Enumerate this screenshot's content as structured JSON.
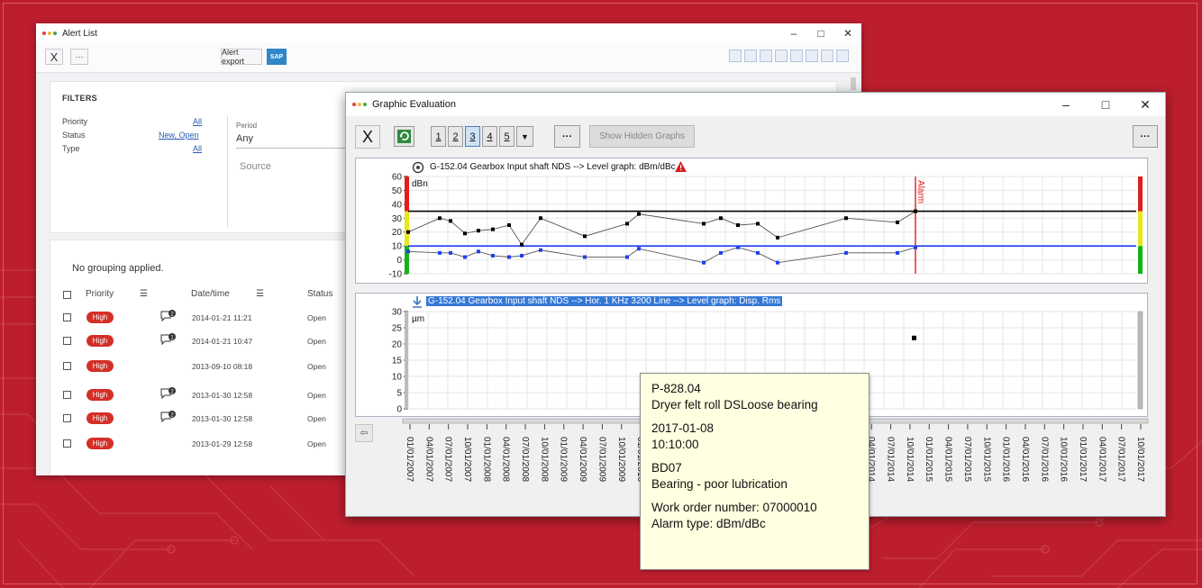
{
  "colors": {
    "background": "#bd1e2d",
    "pill": "#d32f27",
    "link": "#2a5db0",
    "selection": "#3478d6",
    "tooltip_bg": "#ffffe1"
  },
  "alert_window": {
    "title": "Alert List",
    "toolbar": {
      "close_glyph": "X",
      "more_glyph": "···",
      "export_label": "Alert export",
      "sap_label": "SAP"
    },
    "filters": {
      "heading": "FILTERS",
      "rows": [
        {
          "label": "Priority",
          "value": "All"
        },
        {
          "label": "Status",
          "value": "New, Open"
        },
        {
          "label": "Type",
          "value": "All"
        }
      ],
      "period_label": "Period",
      "period_value": "Any",
      "source_placeholder": "Source"
    },
    "list": {
      "grouping_text": "No grouping applied.",
      "columns": {
        "priority": "Priority",
        "datetime": "Date/time",
        "status": "Status"
      },
      "rows": [
        {
          "priority": "High",
          "comments": "2",
          "datetime": "2014-01-21 11:21",
          "status": "Open"
        },
        {
          "priority": "High",
          "comments": "1",
          "datetime": "2014-01-21 10:47",
          "status": "Open"
        },
        {
          "priority": "High",
          "comments": "",
          "datetime": "2013-09-10 08:18",
          "status": "Open"
        },
        {
          "priority": "High",
          "comments": "2",
          "datetime": "2013-01-30 12:58",
          "status": "Open"
        },
        {
          "priority": "High",
          "comments": "2",
          "datetime": "2013-01-30 12:58",
          "status": "Open"
        },
        {
          "priority": "High",
          "comments": "",
          "datetime": "2013-01-29 12:58",
          "status": "Open"
        }
      ]
    }
  },
  "graph_window": {
    "title": "Graphic Evaluation",
    "toolbar": {
      "close_glyph": "X",
      "pages": [
        "1",
        "2",
        "3",
        "4",
        "5"
      ],
      "selected_page": "3",
      "more_glyph": "···",
      "hidden_graphs_label": "Show Hidden Graphs"
    },
    "panel1": {
      "title": "G-152.04 Gearbox Input shaft NDS --> Level graph: dBm/dBc",
      "unit": "dBn",
      "alarm_label": "Alarm",
      "yticks": [
        "60",
        "50",
        "40",
        "30",
        "20",
        "10",
        "0",
        "-10"
      ]
    },
    "panel2": {
      "title": "G-152.04 Gearbox Input shaft NDS --> Hor. 1 KHz 3200 Line --> Level graph: Disp. Rms",
      "unit": "µm",
      "yticks": [
        "30",
        "25",
        "20",
        "15",
        "10",
        "5",
        "0"
      ]
    },
    "xaxis_labels": [
      "01/01/2007",
      "04/01/2007",
      "07/01/2007",
      "10/01/2007",
      "01/01/2008",
      "04/01/2008",
      "07/01/2008",
      "10/01/2008",
      "01/01/2009",
      "04/01/2009",
      "07/01/2009",
      "10/01/2009",
      "01/01/2010",
      "04/01/2010",
      "",
      "",
      "",
      "",
      "",
      "",
      "",
      "",
      "",
      "01/01/2014",
      "04/01/2014",
      "07/01/2014",
      "10/01/2014",
      "01/01/2015",
      "04/01/2015",
      "07/01/2015",
      "10/01/2015",
      "01/01/2016",
      "04/01/2016",
      "07/01/2016",
      "10/01/2016",
      "01/01/2017",
      "04/01/2017",
      "07/01/2017",
      "10/01/2017"
    ],
    "xaxis_partial": "10/01/2013"
  },
  "chart_data": [
    {
      "type": "line",
      "title": "G-152.04 Gearbox Input shaft NDS --> Level graph: dBm/dBc",
      "ylabel": "dBn",
      "ylim": [
        -10,
        60
      ],
      "series": [
        {
          "values": [
            20,
            30,
            28,
            19,
            21,
            22,
            25,
            11,
            30,
            17,
            26,
            33,
            26,
            30,
            25,
            26,
            16,
            30,
            27,
            35
          ]
        },
        {
          "values": [
            6,
            5,
            5,
            2,
            6,
            3,
            2,
            3,
            7,
            2,
            2,
            8,
            -2,
            5,
            9,
            5,
            -2,
            5,
            5,
            9
          ]
        }
      ],
      "alarm_level": 35,
      "reference_level": 10,
      "alarm_marker": "Alarm"
    },
    {
      "type": "scatter",
      "title": "G-152.04 Gearbox Input shaft NDS --> Hor. 1 KHz 3200 Line --> Level graph: Disp. Rms",
      "ylabel": "µm",
      "ylim": [
        0,
        30
      ],
      "values": [
        22
      ]
    }
  ],
  "tooltip": {
    "lines_a": [
      "P-828.04",
      "Dryer felt roll DSLoose bearing"
    ],
    "lines_b": [
      "2017-01-08",
      "10:10:00"
    ],
    "lines_c": [
      "BD07",
      "Bearing - poor lubrication"
    ],
    "lines_d": [
      "Work order number: 07000010",
      "Alarm type: dBm/dBc"
    ]
  }
}
